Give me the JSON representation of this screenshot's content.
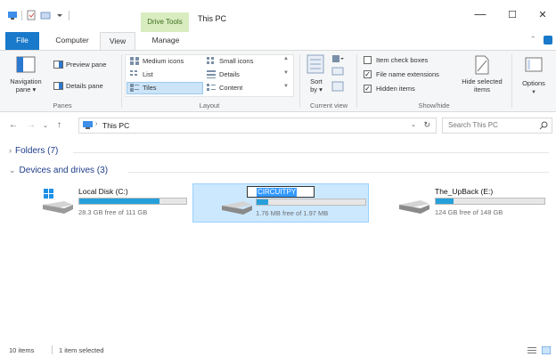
{
  "window": {
    "context_tab": "Drive Tools",
    "title": "This PC",
    "minimize": "—",
    "maximize": "☐",
    "close": "✕"
  },
  "tabs": {
    "file": "File",
    "computer": "Computer",
    "view": "View",
    "manage": "Manage"
  },
  "ribbon": {
    "panes": {
      "navigation_pane": "Navigation\npane ▾",
      "preview_pane": "Preview pane",
      "details_pane": "Details pane",
      "label": "Panes"
    },
    "layout": {
      "medium_icons": "Medium icons",
      "small_icons": "Small icons",
      "list": "List",
      "details": "Details",
      "tiles": "Tiles",
      "content": "Content",
      "label": "Layout"
    },
    "current_view": {
      "sort_by": "Sort\nby ▾",
      "label": "Current view"
    },
    "show_hide": {
      "item_check_boxes": "Item check boxes",
      "file_name_extensions": "File name extensions",
      "hidden_items": "Hidden items",
      "hide_selected_items": "Hide selected\nitems",
      "label": "Show/hide"
    },
    "options": "Options"
  },
  "address": {
    "path": "This PC",
    "search_placeholder": "Search This PC"
  },
  "sections": {
    "folders": "Folders (7)",
    "devices": "Devices and drives (3)"
  },
  "drives": [
    {
      "name": "Local Disk (C:)",
      "free": "28.3 GB free of 111 GB",
      "used_fraction": 0.75
    },
    {
      "name": "CIRCUITPY",
      "free": "1.76 MB free of 1.97 MB",
      "used_fraction": 0.11
    },
    {
      "name": "The_UpBack (E:)",
      "free": "124 GB free of 148 GB",
      "used_fraction": 0.16
    }
  ],
  "status": {
    "items": "10 items",
    "selected": "1 item selected"
  },
  "colors": {
    "accent": "#1979ca",
    "drive_bar": "#26a0da",
    "selection": "#cce8ff",
    "context_tab": "#d9ecc0"
  }
}
